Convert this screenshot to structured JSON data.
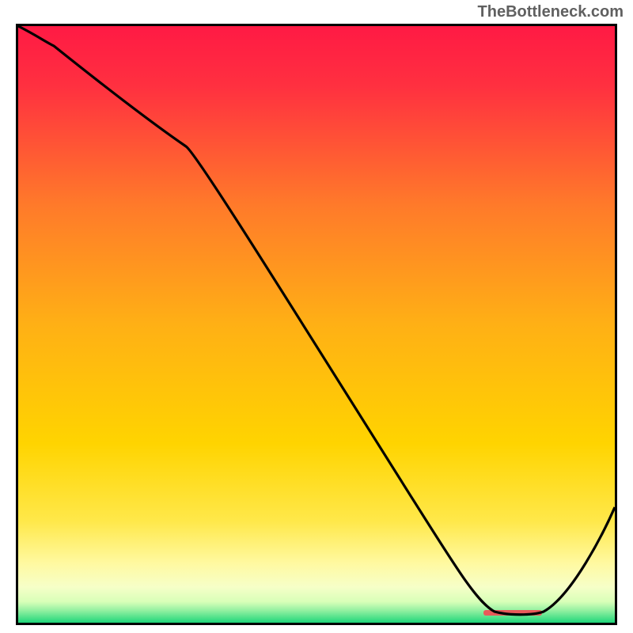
{
  "watermark": "TheBottleneck.com",
  "chart_data": {
    "type": "line",
    "title": "",
    "xlabel": "",
    "ylabel": "",
    "x": [
      0,
      0.06,
      0.28,
      0.8,
      0.87,
      1.0
    ],
    "y": [
      1.0,
      0.98,
      0.8,
      0.02,
      0.02,
      0.2
    ],
    "ylim": [
      0,
      1
    ],
    "xlim": [
      0,
      1
    ],
    "background_gradient": {
      "top": "#ff1a44",
      "mid": "#ffd400",
      "bottom_band": "#e8ffb0",
      "bottom_edge": "#1fd67a"
    },
    "marker": {
      "color": "#e85a5a",
      "x0": 0.78,
      "x1": 0.88,
      "y": 0.015
    }
  }
}
